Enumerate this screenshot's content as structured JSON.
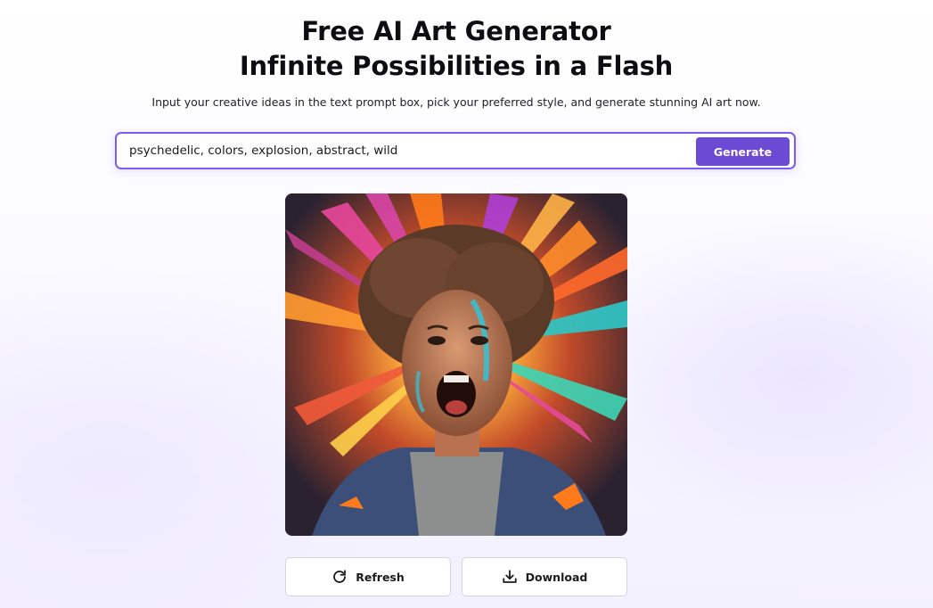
{
  "hero": {
    "title_line1": "Free AI Art Generator",
    "title_line2": "Infinite Possibilities in a Flash",
    "subtitle": "Input your creative ideas in the text prompt box, pick your preferred style, and generate stunning AI art now."
  },
  "prompt": {
    "value": "psychedelic, colors, explosion, abstract, wild",
    "generate_label": "Generate"
  },
  "result": {
    "image_icon": "generated-art-image"
  },
  "actions": {
    "refresh_label": "Refresh",
    "refresh_icon": "refresh-icon",
    "download_label": "Download",
    "download_icon": "download-icon"
  },
  "colors": {
    "accent": "#6c4ad4",
    "accent_border": "#7b5cf0",
    "text": "#111111"
  }
}
